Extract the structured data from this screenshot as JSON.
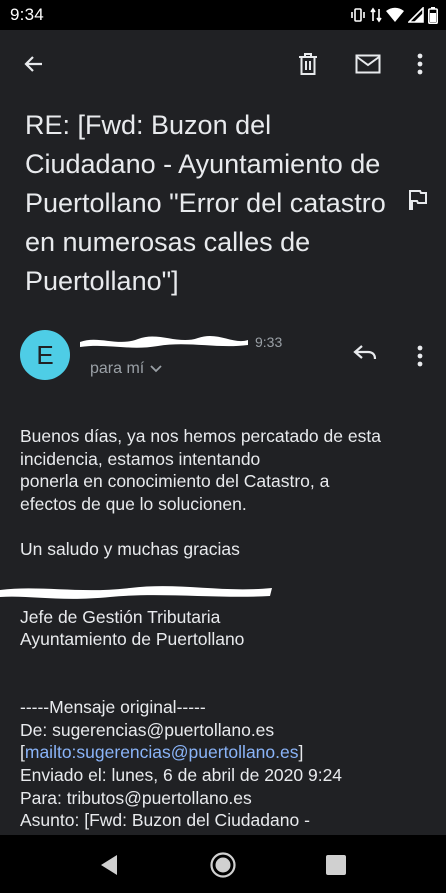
{
  "status_bar": {
    "time": "9:34",
    "icons": [
      "vibrate-icon",
      "data-arrows-icon",
      "wifi-icon",
      "signal-icon",
      "battery-icon"
    ]
  },
  "app_bar": {
    "icons": [
      "back-arrow-icon",
      "delete-icon",
      "mark-unread-icon",
      "more-vert-icon"
    ]
  },
  "email": {
    "subject": "RE: [Fwd: Buzon del Ciudadano - Ayuntamiento de Puertollano \"Error del catastro en numerosas calles de Puertollano\"]",
    "avatar_letter": "E",
    "avatar_color": "#4ecde6",
    "time": "9:33",
    "recipient": "para mí",
    "body": {
      "line1": "Buenos días, ya nos hemos percatado de esta",
      "line2": "incidencia, estamos intentando",
      "line3": "ponerla en conocimiento del Catastro, a",
      "line4": "efectos de que lo solucionen.",
      "greeting": "Un saludo y muchas gracias",
      "sig_title": "Jefe de Gestión Tributaria",
      "sig_org": "Ayuntamiento de Puertollano",
      "orig_header": "-----Mensaje original-----",
      "from": "De: sugerencias@puertollano.es",
      "mailto_open": "[",
      "mailto_link": "mailto:sugerencias@puertollano.es",
      "mailto_close": "]",
      "sent": "Enviado el: lunes, 6 de abril de 2020 9:24",
      "to": "Para: tributos@puertollano.es",
      "subject_line": "Asunto: [Fwd: Buzon del Ciudadano -"
    }
  },
  "colors": {
    "background": "#202124",
    "link": "#8ab4f8",
    "secondary_text": "#9aa0a6"
  }
}
